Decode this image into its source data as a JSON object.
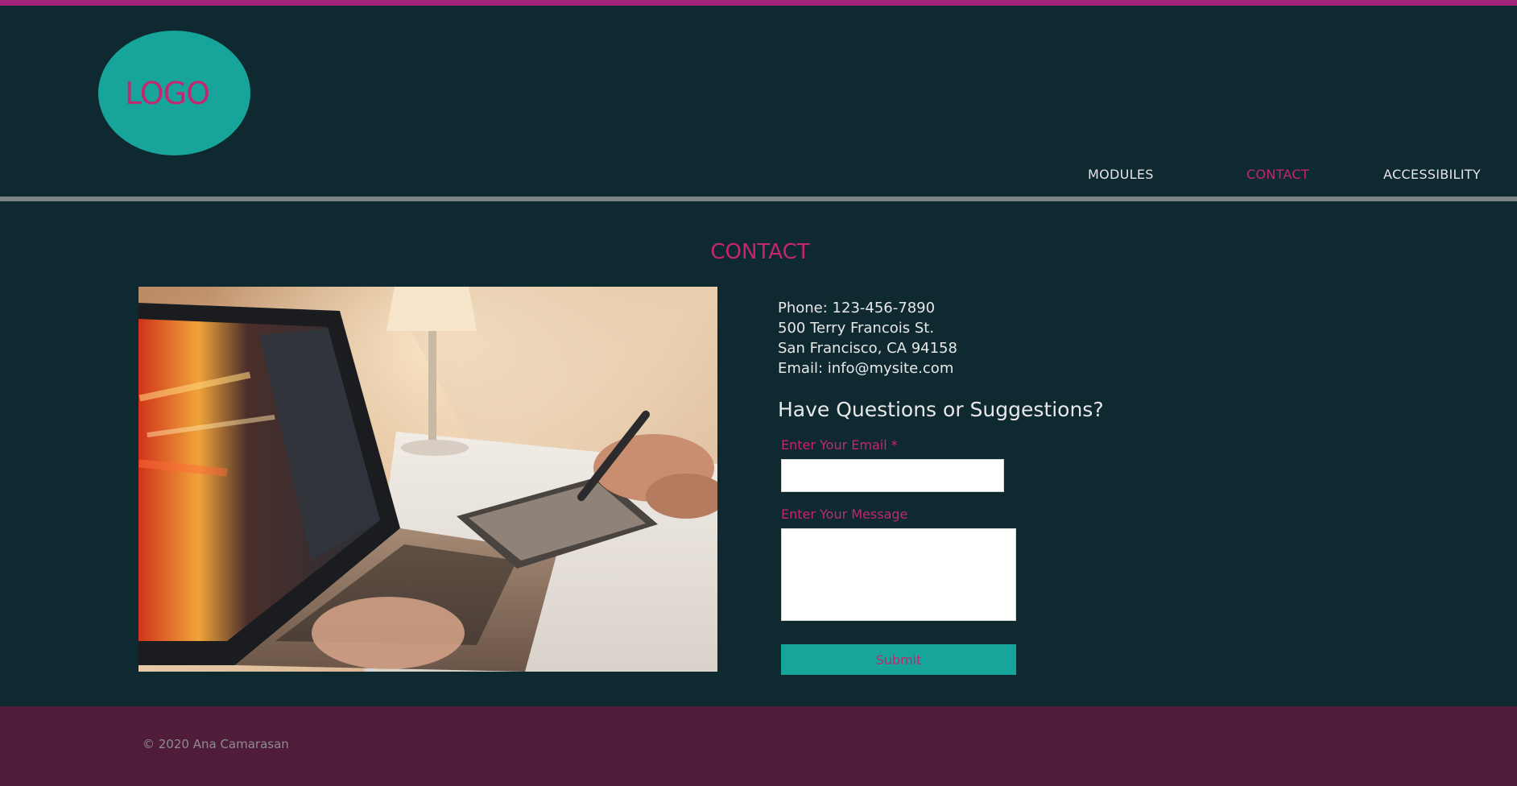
{
  "brand": {
    "logo_text": "LOGO",
    "accent_color": "#c4266f",
    "teal_color": "#17a49a",
    "background_color": "#0f2930",
    "footer_color": "#4f1d39"
  },
  "nav": {
    "items": [
      {
        "label": "MODULES",
        "active": false
      },
      {
        "label": "CONTACT",
        "active": true
      },
      {
        "label": "ACCESSIBILITY",
        "active": false
      }
    ]
  },
  "main": {
    "title": "CONTACT",
    "image_subject": "laptop-and-drawing-tablet-photo",
    "contact": {
      "phone": "Phone: 123-456-7890",
      "address_line1": "500 Terry Francois St.",
      "address_line2": "San Francisco, CA 94158",
      "email": "Email: info@mysite.com"
    },
    "form": {
      "heading": "Have Questions or Suggestions?",
      "email_label": "Enter Your Email *",
      "email_value": "",
      "message_label": "Enter Your Message",
      "message_value": "",
      "submit_label": "Submit"
    }
  },
  "footer": {
    "copyright": "© 2020 Ana Camarasan"
  }
}
